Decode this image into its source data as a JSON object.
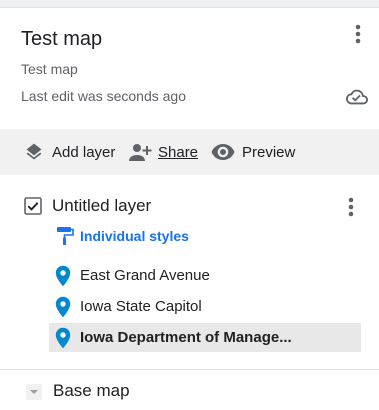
{
  "map": {
    "title": "Test map",
    "description": "Test map",
    "last_edit": "Last edit was seconds ago"
  },
  "toolbar": {
    "add_layer": "Add layer",
    "share": "Share",
    "preview": "Preview"
  },
  "layer": {
    "checked": true,
    "name": "Untitled layer",
    "styles_link": "Individual styles",
    "features": [
      {
        "label": "East Grand Avenue",
        "selected": false
      },
      {
        "label": "Iowa State Capitol",
        "selected": false
      },
      {
        "label": "Iowa Department of Manage...",
        "selected": true
      }
    ]
  },
  "base_map": {
    "label": "Base map"
  },
  "colors": {
    "accent": "#1a73e8",
    "pin": "#0288d1",
    "icon_grey": "#5f6368",
    "toolbar_bg": "#f1f1f1",
    "selected_bg": "#e8e8e8"
  },
  "icons": {
    "map_menu": "more-vert-icon",
    "saved_status": "cloud-done-icon",
    "add_layer": "layers-icon",
    "share": "person-add-icon",
    "preview": "eye-icon",
    "layer_checkbox": "checkbox-checked-icon",
    "layer_menu": "more-vert-icon",
    "styles": "paint-roller-icon",
    "feature": "map-pin-icon",
    "base_map": "arrow-drop-down-icon"
  }
}
